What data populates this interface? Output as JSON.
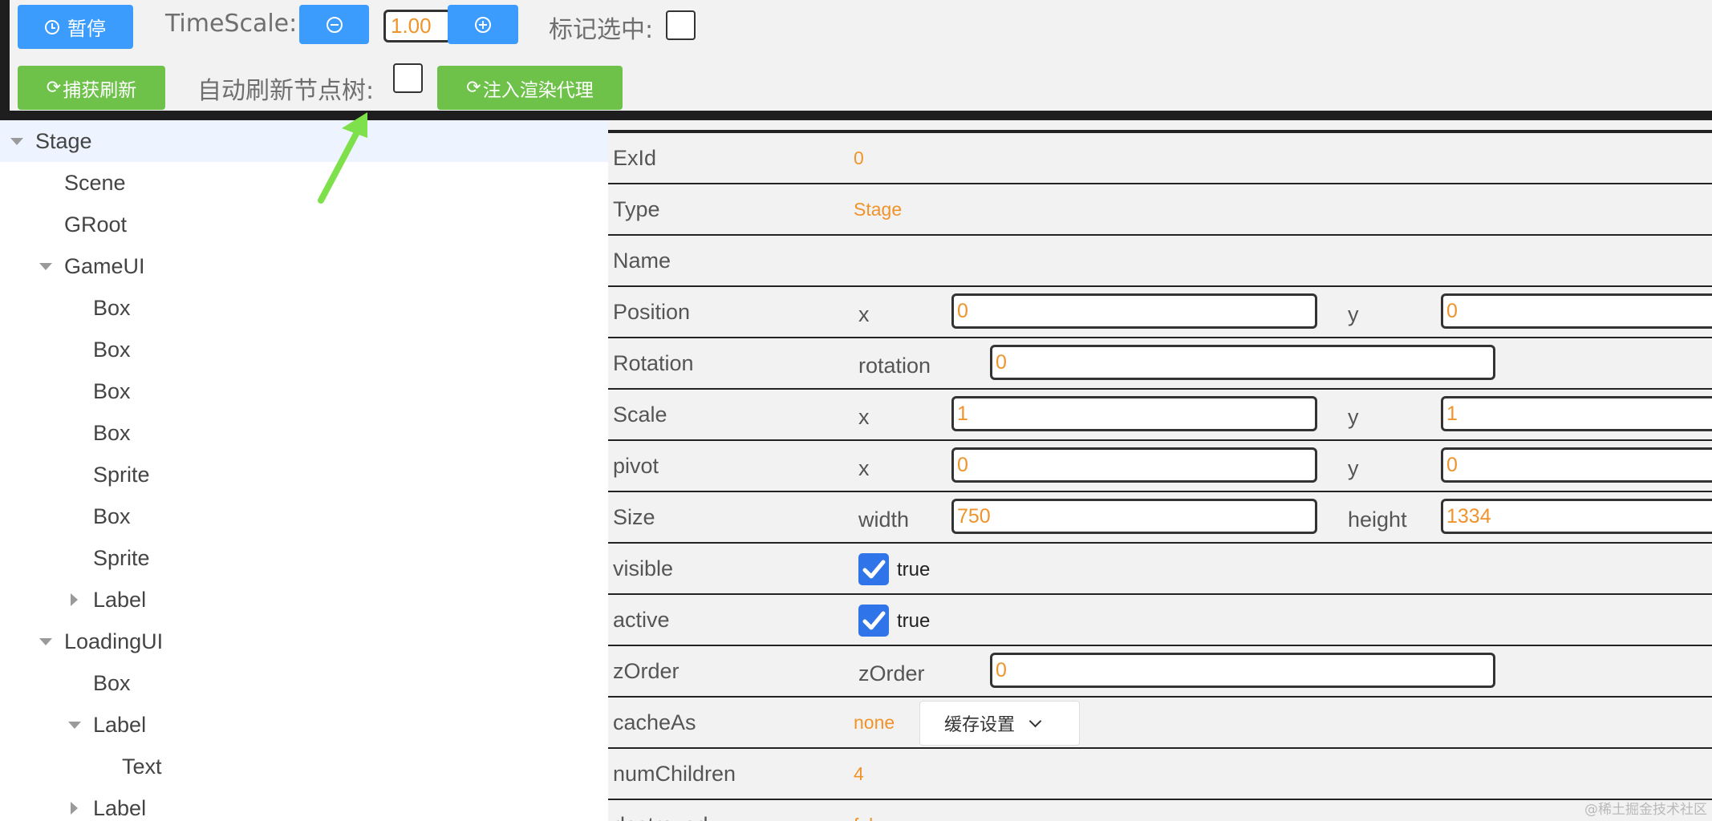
{
  "toolbar": {
    "pause_label": "暂停",
    "timescale_label": "TimeScale:",
    "timescale_value": "1.00",
    "mark_selected_label": "标记选中:",
    "capture_refresh_label": "捕获刷新",
    "auto_refresh_label": "自动刷新节点树:",
    "inject_proxy_label": "注入渲染代理"
  },
  "tree": {
    "nodes": [
      "Stage",
      "Scene",
      "GRoot",
      "GameUI",
      "Box",
      "Box",
      "Box",
      "Box",
      "Sprite",
      "Box",
      "Sprite",
      "Label",
      "LoadingUI",
      "Box",
      "Label",
      "Text",
      "Label"
    ]
  },
  "props": {
    "exid": {
      "name": "ExId",
      "value": "0"
    },
    "type": {
      "name": "Type",
      "value": "Stage"
    },
    "name": {
      "name": "Name",
      "value": ""
    },
    "position": {
      "name": "Position",
      "x_label": "x",
      "x": "0",
      "y_label": "y",
      "y": "0"
    },
    "rotation": {
      "name": "Rotation",
      "label": "rotation",
      "value": "0"
    },
    "scale": {
      "name": "Scale",
      "x_label": "x",
      "x": "1",
      "y_label": "y",
      "y": "1"
    },
    "pivot": {
      "name": "pivot",
      "x_label": "x",
      "x": "0",
      "y_label": "y",
      "y": "0"
    },
    "size": {
      "name": "Size",
      "width_label": "width",
      "width": "750",
      "height_label": "height",
      "height": "1334"
    },
    "visible": {
      "name": "visible",
      "value": "true"
    },
    "active": {
      "name": "active",
      "value": "true"
    },
    "zorder": {
      "name": "zOrder",
      "label": "zOrder",
      "value": "0"
    },
    "cacheas": {
      "name": "cacheAs",
      "value": "none",
      "button": "缓存设置"
    },
    "numchildren": {
      "name": "numChildren",
      "value": "4"
    },
    "partial": {
      "name": "destroyed",
      "value": "false"
    }
  },
  "watermark": "@稀土掘金技术社区",
  "colors": {
    "blue_button": "#3c9cfd",
    "green_button": "#6ec24a",
    "value_orange": "#f0932b",
    "checkbox_blue": "#2f74e8"
  }
}
